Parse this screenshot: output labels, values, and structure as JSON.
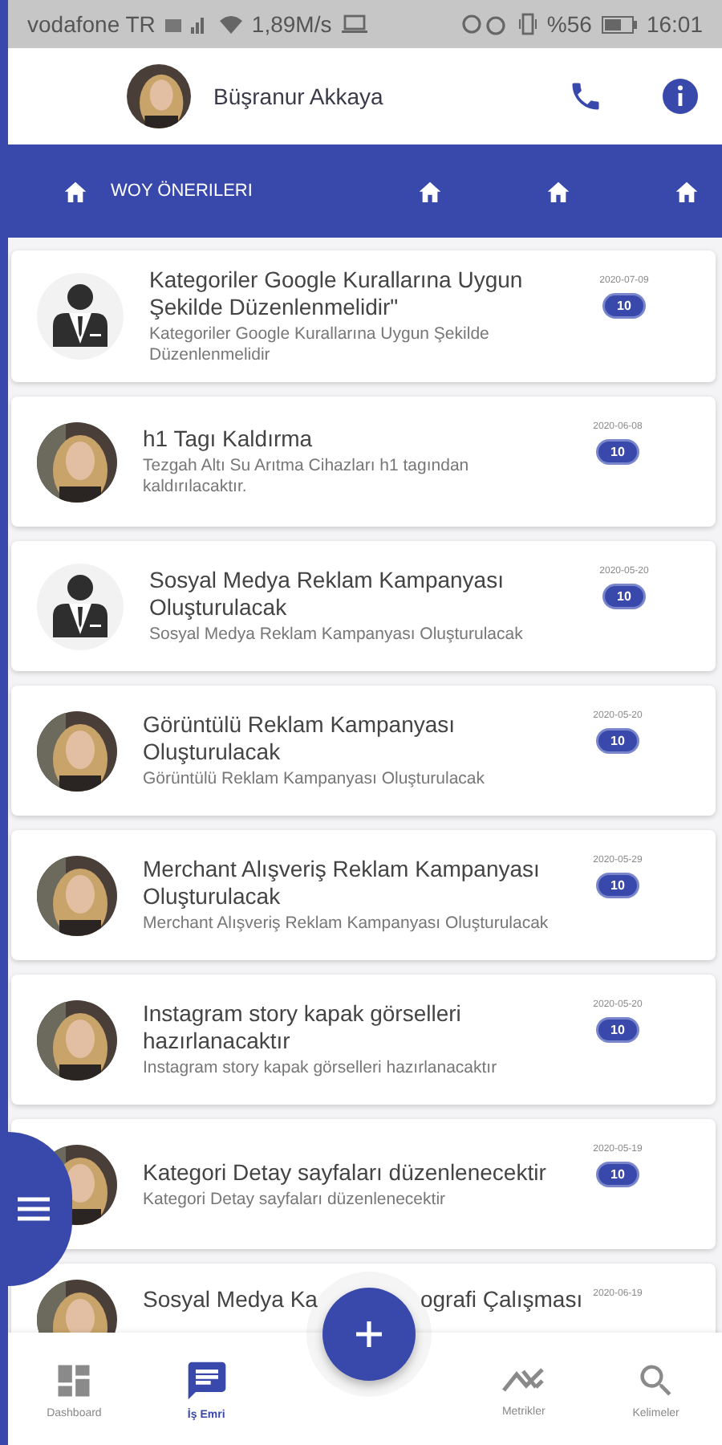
{
  "status_bar": {
    "carrier": "vodafone TR",
    "speed": "1,89M/s",
    "battery": "%56",
    "time": "16:01"
  },
  "header": {
    "name": "Büşranur Akkaya"
  },
  "tabs": [
    {
      "kind": "labeled",
      "label": "WOY ÖNERILERI"
    },
    {
      "kind": "icon"
    },
    {
      "kind": "icon"
    },
    {
      "kind": "icon"
    }
  ],
  "tasks": [
    {
      "kind": "placeholder",
      "title": "Kategoriler Google Kurallarına Uygun Şekilde Düzenlenmelidir\"",
      "subtitle": "Kategoriler Google Kurallarına Uygun Şekilde Düzenlenmelidir",
      "date": "2020-07-09",
      "badge": "10"
    },
    {
      "title": "h1 Tagı Kaldırma",
      "subtitle": "Tezgah Altı Su Arıtma Cihazları h1 tagından kaldırılacaktır.",
      "date": "2020-06-08",
      "badge": "10"
    },
    {
      "kind": "placeholder",
      "title": "Sosyal Medya Reklam Kampanyası Oluşturulacak",
      "subtitle": "Sosyal Medya Reklam Kampanyası Oluşturulacak",
      "date": "2020-05-20",
      "badge": "10"
    },
    {
      "title": "Görüntülü Reklam Kampanyası Oluşturulacak",
      "subtitle": "Görüntülü Reklam Kampanyası Oluşturulacak",
      "date": "2020-05-20",
      "badge": "10"
    },
    {
      "title": "Merchant Alışveriş Reklam Kampanyası Oluşturulacak",
      "subtitle": "Merchant Alışveriş Reklam Kampanyası Oluşturulacak",
      "date": "2020-05-29",
      "badge": "10"
    },
    {
      "title": "Instagram story kapak görselleri hazırlanacaktır",
      "subtitle": "Instagram story kapak görselleri hazırlanacaktır",
      "date": "2020-05-20",
      "badge": "10"
    },
    {
      "title": "Kategori Detay sayfaları düzenlenecektir",
      "subtitle": "Kategori Detay sayfaları düzenlenecektir",
      "date": "2020-05-19",
      "badge": "10"
    }
  ],
  "partial_task": {
    "title_start": "Sosyal Medya Ka",
    "title_end": "ografi Çalışması",
    "date": "2020-06-19"
  },
  "bottom_nav": [
    {
      "kind": "dashboard",
      "label": "Dashboard",
      "selected": false
    },
    {
      "kind": "orders",
      "label": "İş Emri",
      "selected": true
    },
    {
      "kind": "metrics",
      "label": "Metrikler",
      "selected": false
    },
    {
      "kind": "keywords",
      "label": "Kelimeler",
      "selected": false
    }
  ]
}
